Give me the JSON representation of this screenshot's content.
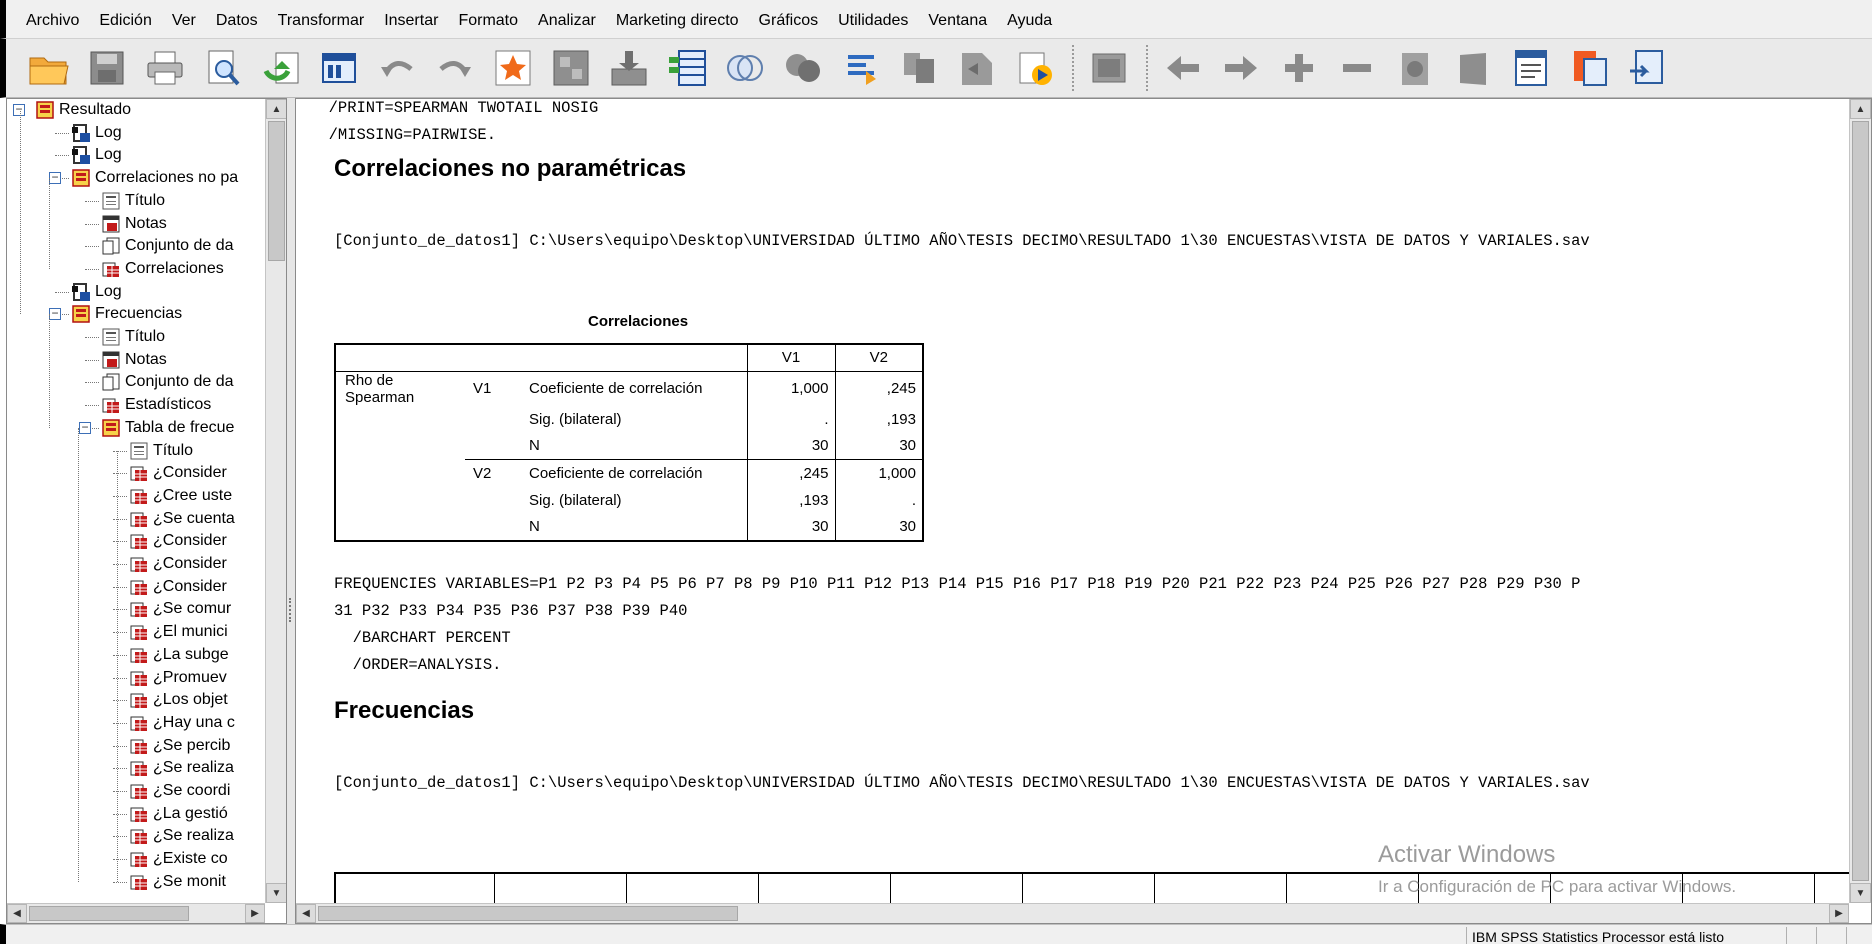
{
  "menu": [
    "Archivo",
    "Edición",
    "Ver",
    "Datos",
    "Transformar",
    "Insertar",
    "Formato",
    "Analizar",
    "Marketing directo",
    "Gráficos",
    "Utilidades",
    "Ventana",
    "Ayuda"
  ],
  "toolbar": {
    "icons": [
      "open-folder-icon",
      "save-icon",
      "print-icon",
      "print-preview-icon",
      "export-icon",
      "recall-dialog-icon",
      "undo-icon",
      "redo-icon",
      "goto-case-icon",
      "goto-variable-icon",
      "variables-icon",
      "data-table-icon",
      "split-file-icon",
      "select-cases-icon",
      "value-labels-icon",
      "use-sets-icon",
      "designate-window-icon",
      "insert-heading-icon",
      "insert-title-icon",
      "insert-text-icon",
      "box-icon",
      "promote-icon",
      "demote-icon",
      "expand-icon",
      "collapse-icon",
      "show-icon",
      "hide-icon",
      "insert-page-break-icon",
      "clipboard-icon",
      "create-output-icon"
    ]
  },
  "navigator": {
    "items": [
      {
        "label": "Resultado",
        "level": 0,
        "icon": "output-book-icon",
        "expander": "minus"
      },
      {
        "label": "Log",
        "level": 1,
        "icon": "log-icon"
      },
      {
        "label": "Log",
        "level": 1,
        "icon": "log-icon"
      },
      {
        "label": "Correlaciones no pa",
        "level": 1,
        "icon": "output-book-icon",
        "expander": "minus"
      },
      {
        "label": "Título",
        "level": 2,
        "icon": "title-icon"
      },
      {
        "label": "Notas",
        "level": 2,
        "icon": "notes-icon"
      },
      {
        "label": "Conjunto de da",
        "level": 2,
        "icon": "dataset-icon"
      },
      {
        "label": "Correlaciones",
        "level": 2,
        "icon": "table-icon"
      },
      {
        "label": "Log",
        "level": 1,
        "icon": "log-icon"
      },
      {
        "label": "Frecuencias",
        "level": 1,
        "icon": "output-book-icon",
        "expander": "minus"
      },
      {
        "label": "Título",
        "level": 2,
        "icon": "title-icon"
      },
      {
        "label": "Notas",
        "level": 2,
        "icon": "notes-icon"
      },
      {
        "label": "Conjunto de da",
        "level": 2,
        "icon": "dataset-icon"
      },
      {
        "label": "Estadísticos",
        "level": 2,
        "icon": "table-icon"
      },
      {
        "label": "Tabla de frecue",
        "level": 2,
        "icon": "output-book-icon",
        "expander": "minus"
      },
      {
        "label": "Título",
        "level": 3,
        "icon": "title-icon"
      },
      {
        "label": "¿Consider",
        "level": 3,
        "icon": "table-icon"
      },
      {
        "label": "¿Cree uste",
        "level": 3,
        "icon": "table-icon"
      },
      {
        "label": "¿Se cuenta",
        "level": 3,
        "icon": "table-icon"
      },
      {
        "label": "¿Consider",
        "level": 3,
        "icon": "table-icon"
      },
      {
        "label": "¿Consider",
        "level": 3,
        "icon": "table-icon"
      },
      {
        "label": "¿Consider",
        "level": 3,
        "icon": "table-icon"
      },
      {
        "label": "¿Se comur",
        "level": 3,
        "icon": "table-icon"
      },
      {
        "label": "¿El munici",
        "level": 3,
        "icon": "table-icon"
      },
      {
        "label": "¿La subge",
        "level": 3,
        "icon": "table-icon"
      },
      {
        "label": "¿Promuev",
        "level": 3,
        "icon": "table-icon"
      },
      {
        "label": "¿Los objet",
        "level": 3,
        "icon": "table-icon"
      },
      {
        "label": "¿Hay una c",
        "level": 3,
        "icon": "table-icon"
      },
      {
        "label": "¿Se percib",
        "level": 3,
        "icon": "table-icon"
      },
      {
        "label": "¿Se realiza",
        "level": 3,
        "icon": "table-icon"
      },
      {
        "label": "¿Se coordi",
        "level": 3,
        "icon": "table-icon"
      },
      {
        "label": "¿La gestió",
        "level": 3,
        "icon": "table-icon"
      },
      {
        "label": "¿Se realiza",
        "level": 3,
        "icon": "table-icon"
      },
      {
        "label": "¿Existe co",
        "level": 3,
        "icon": "table-icon"
      },
      {
        "label": "¿Se monit",
        "level": 3,
        "icon": "table-icon"
      }
    ]
  },
  "output": {
    "syntax_top": [
      "  /PRINT=SPEARMAN TWOTAIL NOSIG",
      "  /MISSING=PAIRWISE."
    ],
    "heading1": "Correlaciones no paramétricas",
    "dataset1": "[Conjunto_de_datos1] C:\\Users\\equipo\\Desktop\\UNIVERSIDAD ÚLTIMO AÑO\\TESIS DECIMO\\RESULTADO 1\\30 ENCUESTAS\\VISTA DE DATOS Y VARIALES.sav",
    "corr_table": {
      "title": "Correlaciones",
      "col_headers": [
        "V1",
        "V2"
      ],
      "row_group": "Rho de Spearman",
      "blocks": [
        {
          "var": "V1",
          "rows": [
            {
              "stat": "Coeficiente de correlación",
              "v1": "1,000",
              "v2": ",245"
            },
            {
              "stat": "Sig. (bilateral)",
              "v1": ".",
              "v2": ",193"
            },
            {
              "stat": "N",
              "v1": "30",
              "v2": "30"
            }
          ]
        },
        {
          "var": "V2",
          "rows": [
            {
              "stat": "Coeficiente de correlación",
              "v1": ",245",
              "v2": "1,000"
            },
            {
              "stat": "Sig. (bilateral)",
              "v1": ",193",
              "v2": "."
            },
            {
              "stat": "N",
              "v1": "30",
              "v2": "30"
            }
          ]
        }
      ]
    },
    "syntax_freq": [
      "FREQUENCIES VARIABLES=P1 P2 P3 P4 P5 P6 P7 P8 P9 P10 P11 P12 P13 P14 P15 P16 P17 P18 P19 P20 P21 P22 P23 P24 P25 P26 P27 P28 P29 P30 P",
      "31 P32 P33 P34 P35 P36 P37 P38 P39 P40",
      "  /BARCHART PERCENT",
      "  /ORDER=ANALYSIS."
    ],
    "heading2": "Frecuencias",
    "dataset2": "[Conjunto_de_datos1] C:\\Users\\equipo\\Desktop\\UNIVERSIDAD ÚLTIMO AÑO\\TESIS DECIMO\\RESULTADO 1\\30 ENCUESTAS\\VISTA DE DATOS Y VARIALES.sav"
  },
  "watermark": {
    "title": "Activar Windows",
    "subtitle": "Ir a Configuración de PC para activar Windows."
  },
  "status": {
    "text": "IBM SPSS Statistics Processor está listo"
  }
}
